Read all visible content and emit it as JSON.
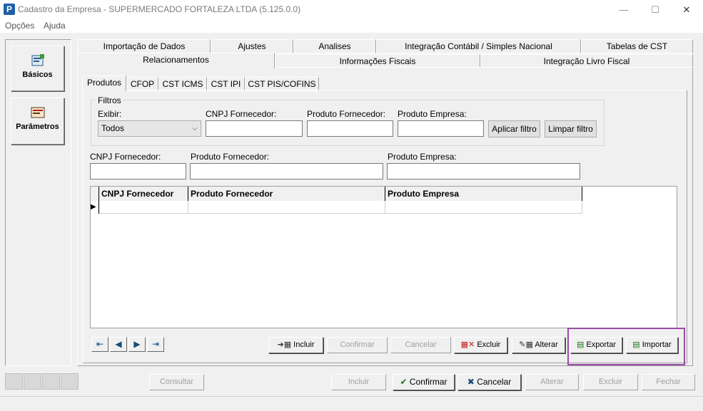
{
  "window": {
    "title": "Cadastro da Empresa - SUPERMERCADO FORTALEZA LTDA (5.125.0.0)",
    "app_icon_letter": "P",
    "minimize": "—",
    "maximize": "☐",
    "close": "✕"
  },
  "menu": [
    "Opções",
    "Ajuda"
  ],
  "side": {
    "basicos": "Básicos",
    "parametros": "Parâmetros"
  },
  "tabs_row1": [
    "Importação de Dados",
    "Ajustes",
    "Analises",
    "Integração Contábil / Simples Nacional",
    "Tabelas de CST"
  ],
  "tabs_row2": [
    "Relacionamentos",
    "Informações Fiscais",
    "Integração Livro Fiscal"
  ],
  "subtabs": [
    "Produtos",
    "CFOP",
    "CST ICMS",
    "CST IPI",
    "CST PIS/COFINS"
  ],
  "filters": {
    "legend": "Filtros",
    "exibir_label": "Exibir:",
    "exibir_value": "Todos",
    "cnpj_label": "CNPJ Fornecedor:",
    "produto_fornecedor_label": "Produto Fornecedor:",
    "produto_empresa_label": "Produto Empresa:",
    "aplicar": "Aplicar filtro",
    "limpar": "Limpar filtro"
  },
  "edit": {
    "cnpj_label": "CNPJ Fornecedor:",
    "produto_fornecedor_label": "Produto Fornecedor:",
    "produto_empresa_label": "Produto Empresa:"
  },
  "grid": {
    "columns": [
      "CNPJ Fornecedor",
      "Produto Fornecedor",
      "Produto Empresa"
    ],
    "row_indicator": "▶"
  },
  "inner_buttons": {
    "incluir": "Incluir",
    "confirmar": "Confirmar",
    "cancelar": "Cancelar",
    "excluir": "Excluir",
    "alterar": "Alterar",
    "exportar": "Exportar",
    "importar": "Importar"
  },
  "bottom_buttons": {
    "consultar": "Consultar",
    "incluir": "Incluir",
    "confirmar": "Confirmar",
    "cancelar": "Cancelar",
    "alterar": "Alterar",
    "excluir": "Excluir",
    "fechar": "Fechar"
  },
  "colors": {
    "highlight": "#9b4aa8",
    "confirm_check": "#1a7a1a",
    "cancel_x": "#1b4b7a"
  }
}
